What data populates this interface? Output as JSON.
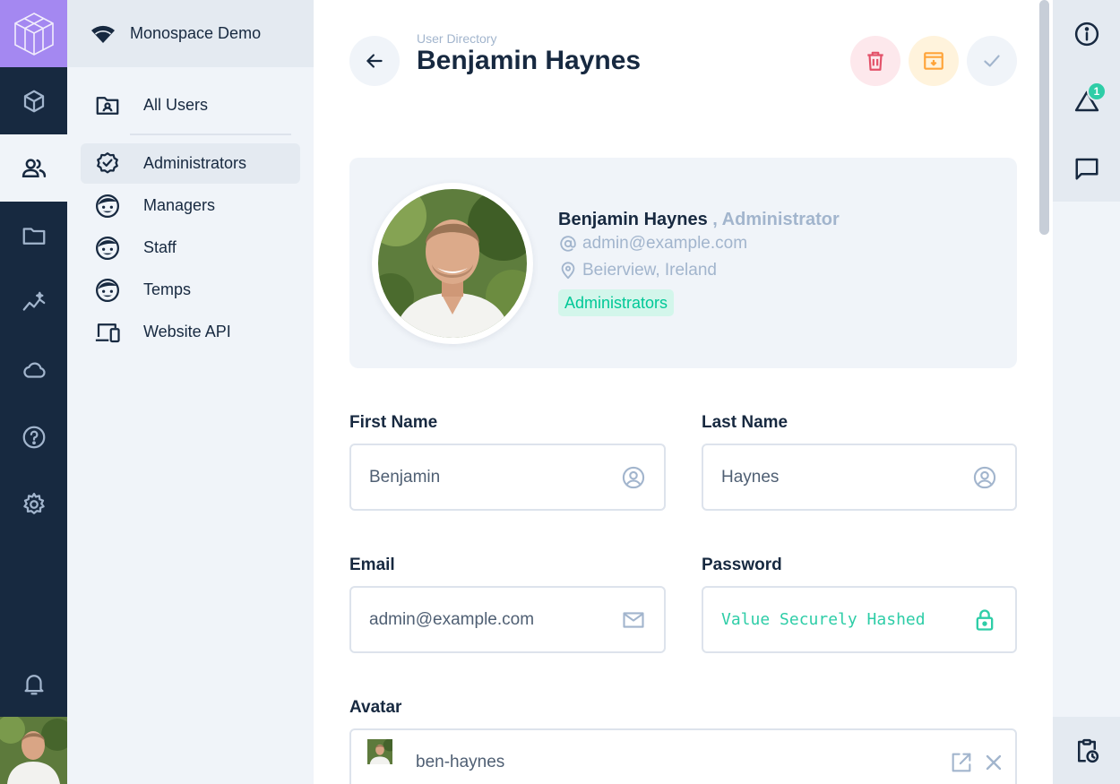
{
  "project": {
    "name": "Monospace Demo"
  },
  "modules": [
    {
      "icon": "cube-icon"
    },
    {
      "icon": "users-icon"
    },
    {
      "icon": "folder-icon"
    },
    {
      "icon": "insights-icon"
    },
    {
      "icon": "cloud-icon"
    },
    {
      "icon": "help-icon"
    },
    {
      "icon": "settings-icon"
    },
    {
      "icon": "bell-icon"
    }
  ],
  "nav": {
    "items": [
      {
        "label": "All Users"
      },
      {
        "label": "Administrators"
      },
      {
        "label": "Managers"
      },
      {
        "label": "Staff"
      },
      {
        "label": "Temps"
      },
      {
        "label": "Website API"
      }
    ]
  },
  "header": {
    "breadcrumb": "User Directory",
    "title": "Benjamin Haynes"
  },
  "profile": {
    "name": "Benjamin Haynes",
    "role": ", Administrator",
    "email": "admin@example.com",
    "location": "Beierview, Ireland",
    "badge": "Administrators"
  },
  "form": {
    "first_name": {
      "label": "First Name",
      "value": "Benjamin"
    },
    "last_name": {
      "label": "Last Name",
      "value": "Haynes"
    },
    "email": {
      "label": "Email",
      "value": "admin@example.com"
    },
    "password": {
      "label": "Password",
      "value": "Value Securely Hashed"
    },
    "avatar": {
      "label": "Avatar",
      "file": "ben-haynes"
    }
  },
  "sidebar": {
    "notifications_count": "1"
  },
  "colors": {
    "module_bar": "#172940",
    "logo": "#a488f1",
    "accent_green": "#00c897",
    "danger": "#e35169",
    "warning": "#ffa439"
  }
}
